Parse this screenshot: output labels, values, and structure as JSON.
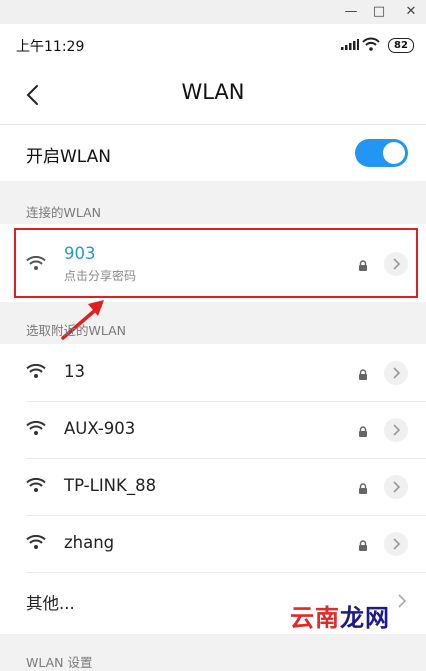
{
  "window": {
    "minimize": "—",
    "maximize": "□",
    "close": "✕"
  },
  "status_bar": {
    "time": "上午11:29",
    "battery": "82"
  },
  "header": {
    "title": "WLAN"
  },
  "toggle": {
    "label": "开启WLAN",
    "on": true
  },
  "connected_section": {
    "title": "连接的WLAN",
    "network": {
      "name": "903",
      "subtitle": "点击分享密码"
    }
  },
  "nearby_section": {
    "title": "选取附近的WLAN",
    "networks": [
      {
        "name": "13"
      },
      {
        "name": "AUX-903"
      },
      {
        "name": "TP-LINK_88"
      },
      {
        "name": "zhang"
      }
    ]
  },
  "other": {
    "label": "其他..."
  },
  "settings_section": {
    "title": "WLAN 设置"
  },
  "watermark": {
    "text_a": "云南",
    "text_b": "龙网"
  },
  "colors": {
    "accent": "#2197f3",
    "connected_name": "#1f9bd2",
    "highlight": "#e02020"
  }
}
